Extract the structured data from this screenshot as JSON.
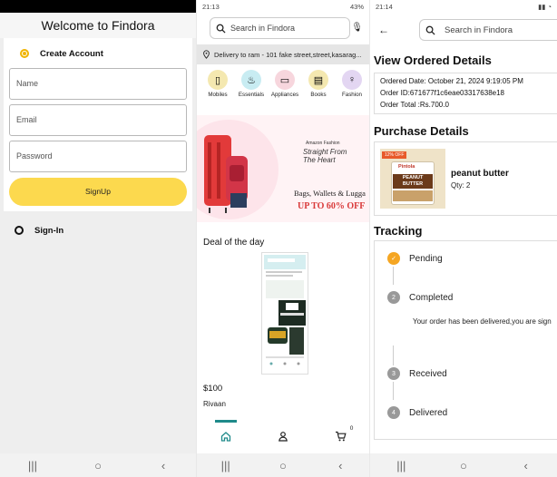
{
  "screen1": {
    "title": "Welcome to Findora",
    "create_account_label": "Create Account",
    "name_placeholder": "Name",
    "email_placeholder": "Email",
    "password_placeholder": "Password",
    "signup_label": "SignUp",
    "signin_label": "Sign-In"
  },
  "screen2": {
    "status_time": "21:13",
    "status_battery": "43%",
    "search_placeholder": "Search in Findora",
    "delivery_text": "Delivery to ram - 101 fake street,street,kasarag...",
    "categories": [
      {
        "label": "Mobiles",
        "icon": "mobile-icon",
        "color": "#f4e8b0"
      },
      {
        "label": "Essentials",
        "icon": "essentials-icon",
        "color": "#c8ecf2"
      },
      {
        "label": "Appliances",
        "icon": "appliance-icon",
        "color": "#f7d6dd"
      },
      {
        "label": "Books",
        "icon": "book-icon",
        "color": "#f4e8b0"
      },
      {
        "label": "Fashion",
        "icon": "fashion-icon",
        "color": "#e3d6f2"
      }
    ],
    "banner": {
      "brand": "Amazon Fashion",
      "tagline": "Straight From The Heart",
      "category_text": "Bags, Wallets & Lugga",
      "offer_text": "UP TO 60% OFF"
    },
    "deal_title": "Deal of the day",
    "deal_price": "$100",
    "deal_vendor": "Rivaan",
    "cart_count": "0"
  },
  "screen3": {
    "status_time": "21:14",
    "search_placeholder": "Search in Findora",
    "view_title": "View Ordered Details",
    "ordered_date": "Ordered Date: October 21, 2024 9:19:05 PM",
    "order_id": "Order ID:671677f1c6eae03317638e18",
    "order_total": "Order Total :Rs.700.0",
    "purchase_title": "Purchase Details",
    "product_name": "peanut butter",
    "product_qty": "Qty: 2",
    "badge_text": "12% OFF",
    "product_brand": "Pintola",
    "product_label": "PEANUT BUTTER",
    "tracking_title": "Tracking",
    "steps": [
      "Pending",
      "Completed",
      "Received",
      "Delivered"
    ],
    "step_numbers": [
      "2",
      "3",
      "4"
    ],
    "tracking_message": "Your order has been delivered,you are sign"
  }
}
